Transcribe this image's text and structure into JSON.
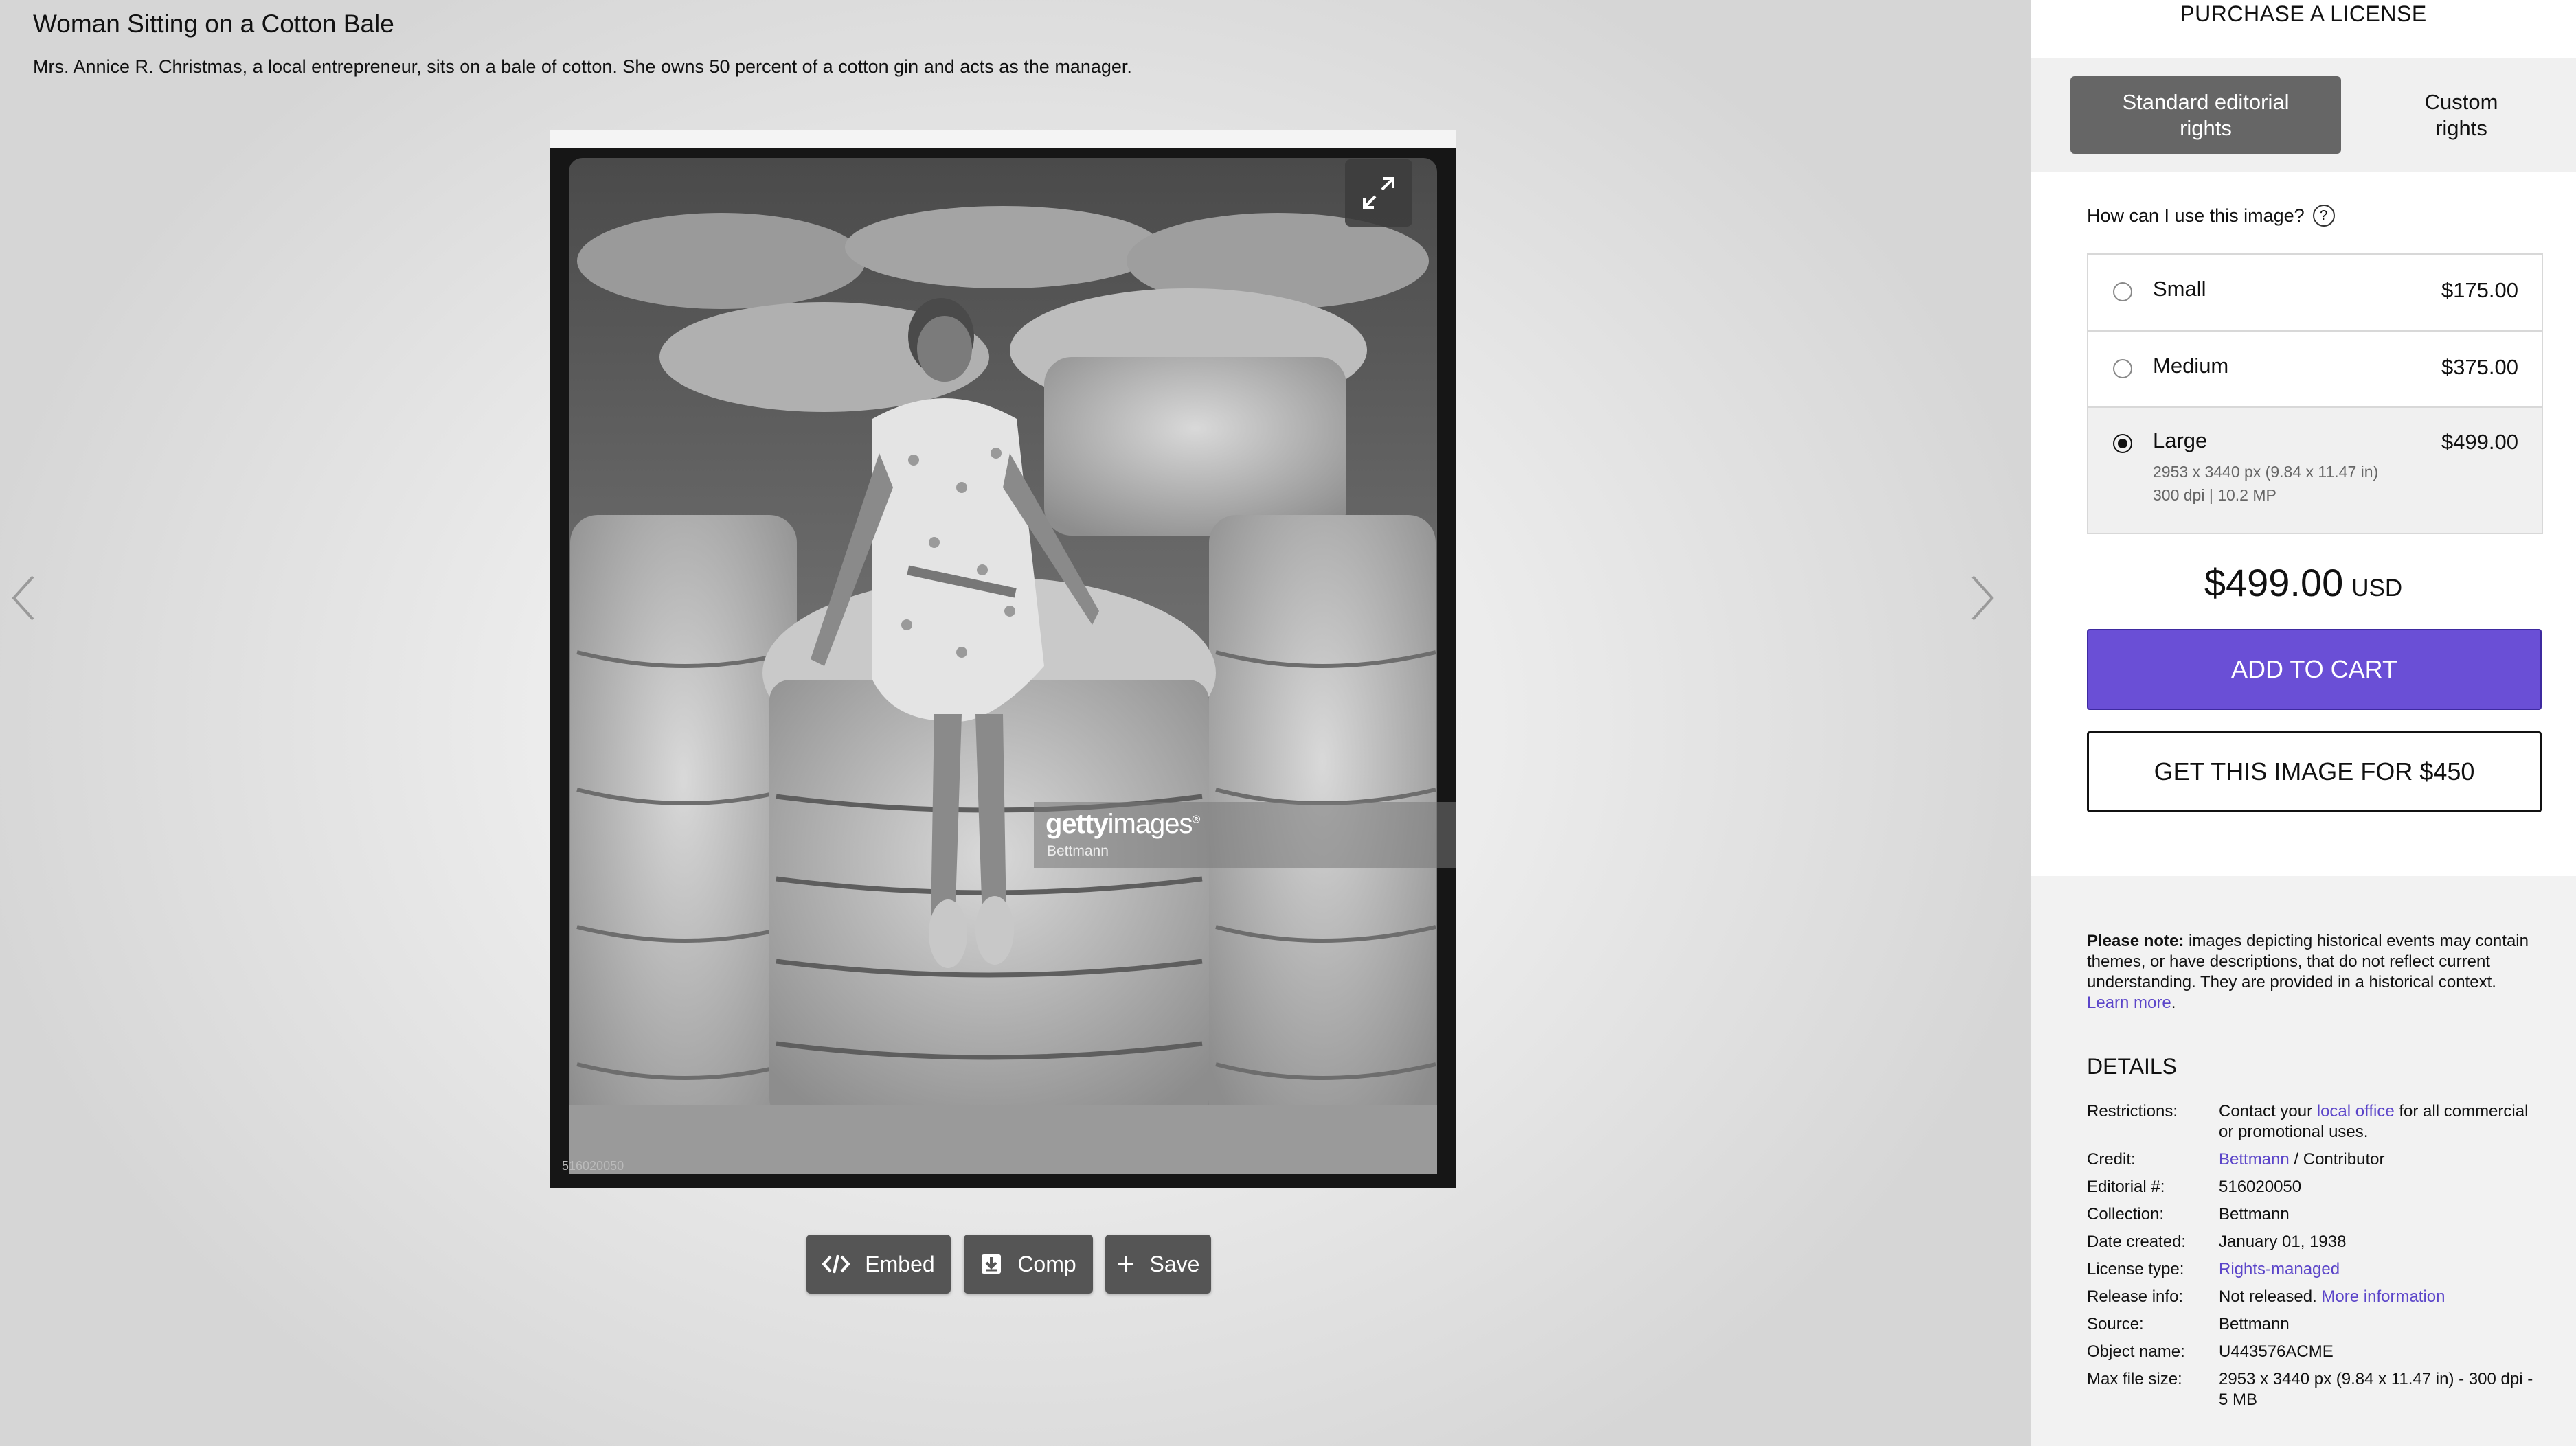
{
  "header": {
    "title": "Woman Sitting on a Cotton Bale",
    "description": "Mrs. Annice R. Christmas, a local entrepreneur, sits on a bale of cotton. She owns 50 percent of a cotton gin and acts as the manager."
  },
  "photo": {
    "watermark_brand_bold": "getty",
    "watermark_brand_thin": "images",
    "watermark_trademark": "®",
    "watermark_credit": "Bettmann",
    "id_stamp": "516020050"
  },
  "actions": {
    "embed": "Embed",
    "comp": "Comp",
    "save": "Save"
  },
  "sidebar": {
    "purchase_title": "PURCHASE A LICENSE",
    "tabs": [
      {
        "line1": "Standard editorial",
        "line2": "rights",
        "active": true
      },
      {
        "line1": "Custom",
        "line2": "rights",
        "active": false
      }
    ],
    "usage_question": "How can I use this image?",
    "help_glyph": "?",
    "sizes": [
      {
        "name": "Small",
        "price": "$175.00",
        "selected": false
      },
      {
        "name": "Medium",
        "price": "$375.00",
        "selected": false
      },
      {
        "name": "Large",
        "price": "$499.00",
        "selected": true,
        "dimensions": "2953 x 3440 px (9.84 x 11.47 in)",
        "resolution": "300 dpi | 10.2 MP"
      }
    ],
    "total_amount": "$499.00",
    "total_currency": "USD",
    "add_to_cart": "ADD TO CART",
    "get_image": "GET THIS IMAGE FOR $450",
    "note_bold": "Please note:",
    "note_text": " images depicting historical events may contain themes, or have descriptions, that do not reflect current understanding. They are provided in a historical context. ",
    "note_link": "Learn more",
    "note_end": ".",
    "accent_color": "#6a4fd6",
    "details_title": "DETAILS",
    "details": {
      "restrictions_label": "Restrictions:",
      "restrictions_pre": "Contact your ",
      "restrictions_link": "local office",
      "restrictions_post": " for all commercial or promotional uses.",
      "credit_label": "Credit:",
      "credit_link": "Bettmann",
      "credit_post": " / Contributor",
      "editorial_label": "Editorial #:",
      "editorial_value": "516020050",
      "collection_label": "Collection:",
      "collection_value": "Bettmann",
      "date_label": "Date created:",
      "date_value": "January 01, 1938",
      "license_label": "License type:",
      "license_value": "Rights-managed",
      "release_label": "Release info:",
      "release_pre": "Not released. ",
      "release_link": "More information",
      "source_label": "Source:",
      "source_value": "Bettmann",
      "object_label": "Object name:",
      "object_value": "U443576ACME",
      "filesize_label": "Max file size:",
      "filesize_value": "2953 x 3440 px (9.84 x 11.47 in) - 300 dpi - 5 MB"
    }
  }
}
